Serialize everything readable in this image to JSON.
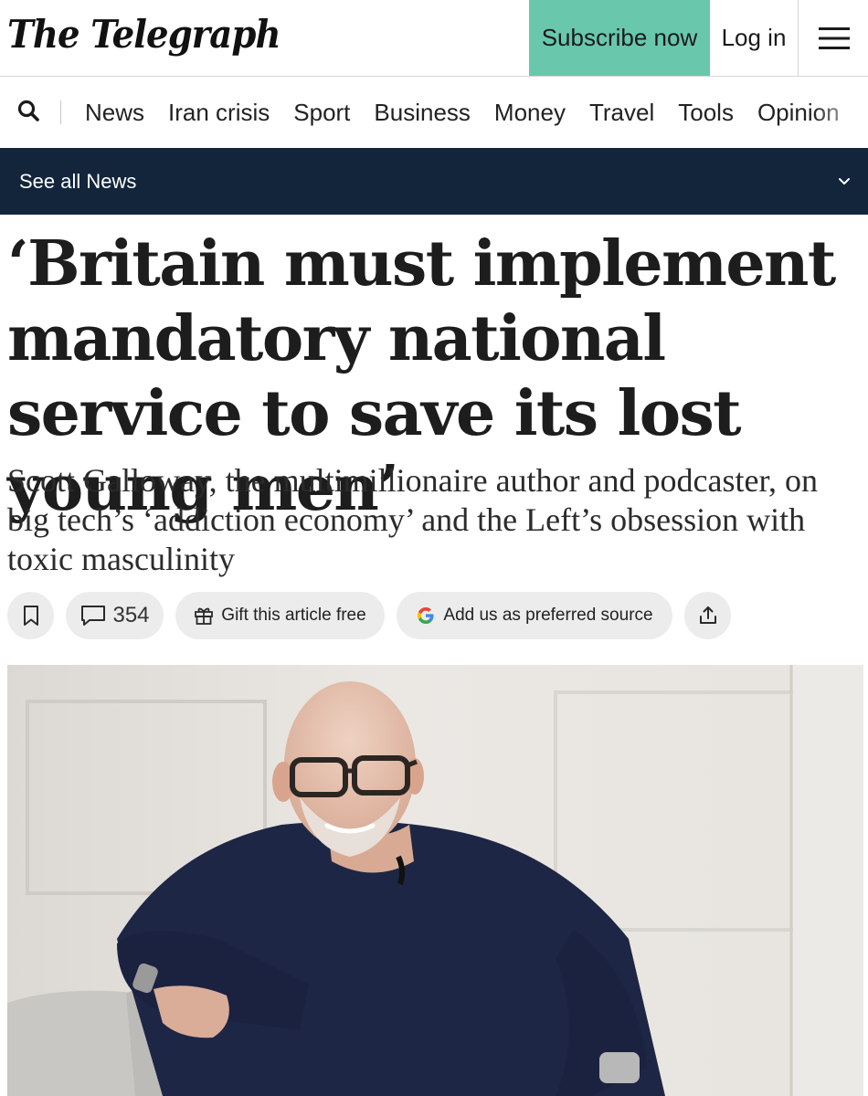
{
  "header": {
    "logo": "The Telegraph",
    "subscribe_label": "Subscribe now",
    "login_label": "Log in",
    "menu_icon": "hamburger-menu-icon"
  },
  "nav": {
    "search_icon": "search-icon",
    "items": [
      "News",
      "Iran crisis",
      "Sport",
      "Business",
      "Money",
      "Travel",
      "Tools",
      "Opinion"
    ]
  },
  "section_bar": {
    "label": "See all News",
    "icon": "chevron-down-icon"
  },
  "article": {
    "headline": "‘Britain must implement mandatory national service to save its lost young men’",
    "standfirst": "Scott Galloway, the multimillionaire author and podcaster, on big tech’s ‘addiction economy’ and the Left’s obsession with toxic masculinity"
  },
  "actions": {
    "bookmark_icon": "bookmark-icon",
    "comment_count": "354",
    "gift_label": "Gift this article free",
    "google_label": "Add us as preferred source",
    "share_icon": "share-icon"
  },
  "colors": {
    "subscribe_bg": "#69c7ac",
    "section_bar_bg": "#12253b",
    "pill_bg": "#ececec"
  }
}
